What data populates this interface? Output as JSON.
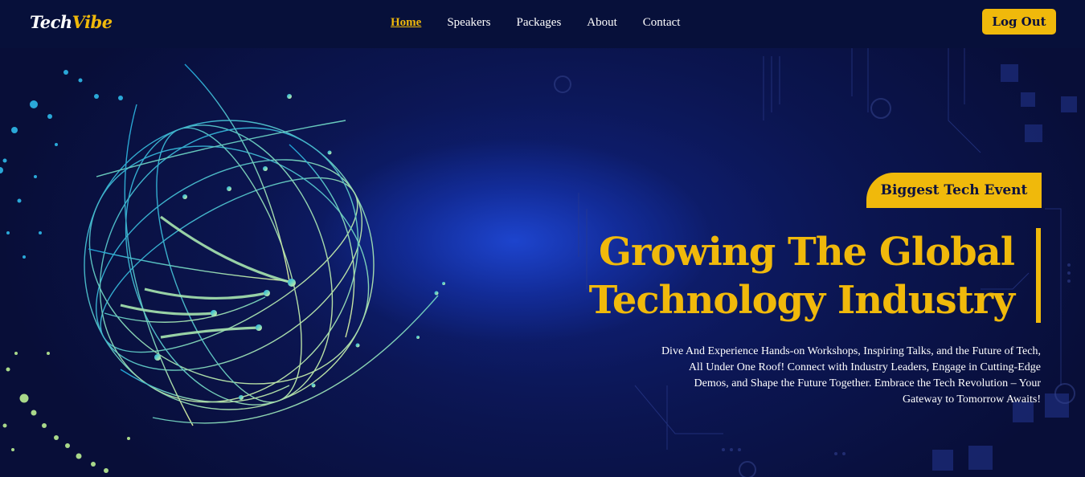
{
  "brand": {
    "name_part1": "Tech",
    "name_part2": "Vibe"
  },
  "nav": {
    "links": [
      {
        "label": "Home",
        "active": true
      },
      {
        "label": "Speakers",
        "active": false
      },
      {
        "label": "Packages",
        "active": false
      },
      {
        "label": "About",
        "active": false
      },
      {
        "label": "Contact",
        "active": false
      }
    ],
    "logout_label": "Log Out"
  },
  "hero": {
    "badge": "Biggest Tech Event",
    "headline_line1": "Growing The Global",
    "headline_line2": "Technology Industry",
    "description_line1": "Dive And Experience Hands-on Workshops, Inspiring Talks, and the Future of Tech,",
    "description_line2": "All Under One Roof! Connect with Industry Leaders, Engage in Cutting-Edge",
    "description_line3": "Demos, and Shape the Future Together. Embrace the Tech Revolution – Your",
    "description_line4": "Gateway to Tomorrow Awaits!"
  },
  "colors": {
    "accent": "#f0b90b",
    "navbar_bg": "#07103a",
    "hero_bg": "#0b1550",
    "text": "#ffffff"
  },
  "icons": {
    "globe": "network-globe-illustration",
    "circuit": "circuit-board-pattern"
  }
}
